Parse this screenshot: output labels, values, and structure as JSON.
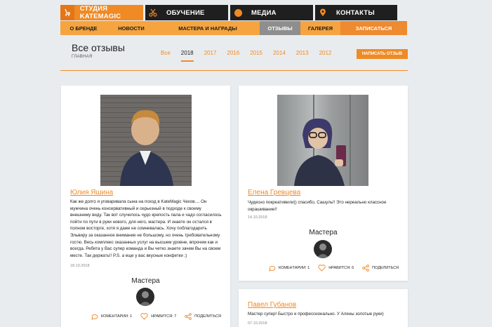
{
  "topnav": {
    "items": [
      "СТУДИЯ KATEMAGIC",
      "ОБУЧЕНИЕ",
      "МЕДИА",
      "КОНТАКТЫ"
    ]
  },
  "subnav": {
    "items": [
      "О БРЕНДЕ",
      "НОВОСТИ",
      "МАСТЕРА И НАГРАДЫ",
      "ОТЗЫВЫ",
      "ГАЛЕРЕЯ",
      "ЗАПИСАТЬСЯ"
    ]
  },
  "page": {
    "title": "Все отзывы",
    "breadcrumb": "ГЛАВНАЯ",
    "write_button": "НАПИСАТЬ ОТЗЫВ"
  },
  "years": [
    "Все",
    "2018",
    "2017",
    "2016",
    "2015",
    "2014",
    "2013",
    "2012"
  ],
  "reviews": [
    {
      "name": "Юлия Яшина",
      "text": "Как же долго я уговаривала сына на поход в KateMagic Чехов.... Он мужчина очень консервативный и серьезный в подходе к своему внешнему виду. Так вот случилось чудо крепость пала и чадо согласилось пойти по пути в руки нового, для него, мастера. И знаете он остался в полном восторге, хотя я даже не сомневалась. Хочу поблагодарить Эльвиру за оказанное внимание не большому, но очень требовательному гостю. Весь комплекс оказанных услуг на высшем уровне, впрочем как и всегда. Ребята у Вас супер команда и Вы четко знаете зачем Вы на своем месте. Так держать!! P.S. а еще у вас вкусные конфетки ;)",
      "date": "18.10.2018",
      "masters": "Мастера",
      "comments": "КОМЕНТАРИИ: 1",
      "likes": "НРАВИТСЯ: 7",
      "share": "ПОДЕЛИТЬСЯ"
    },
    {
      "name": "Елена Гревцева",
      "text": "Чудесно покреативили)) спасибо, Сашуль!! Это нереально классное окрашивание!!",
      "date": "14.10.2018",
      "masters": "Мастера",
      "comments": "КОМЕНТАРИИ: 1",
      "likes": "НРАВИТСЯ: 6",
      "share": "ПОДЕЛИТЬСЯ"
    },
    {
      "name": "Павел Губанов",
      "text": "Мастер супер! Быстро и профессионально. У Алены золотые руки)",
      "date": "07.10.2018"
    }
  ],
  "colors": {
    "accent": "#f08a24",
    "dark": "#1f1f1f",
    "background": "#e9ecef"
  }
}
